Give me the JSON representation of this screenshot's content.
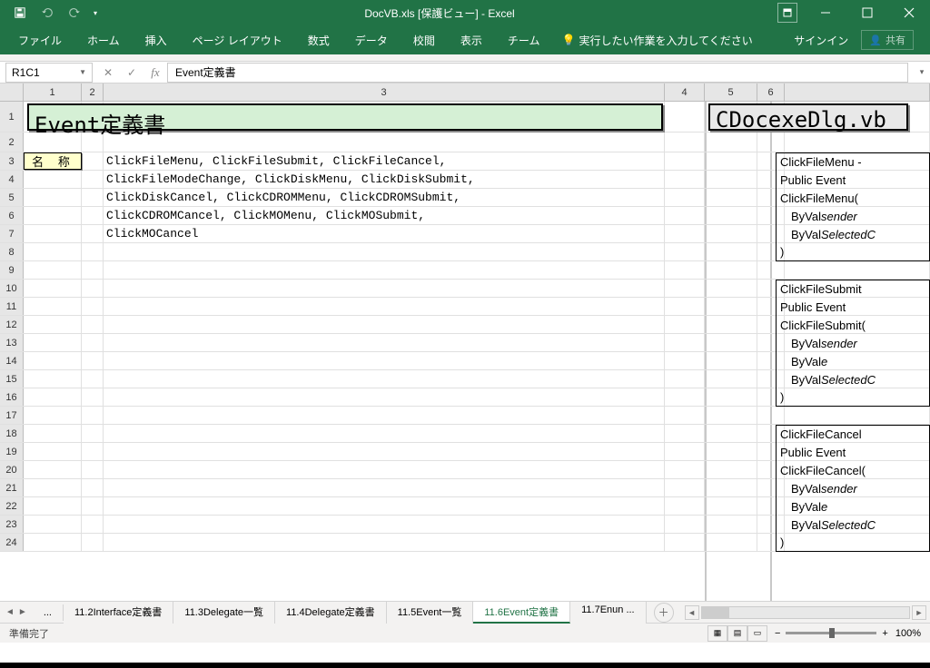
{
  "title": "DocVB.xls  [保護ビュー] - Excel",
  "ribbon": {
    "tabs": [
      "ファイル",
      "ホーム",
      "挿入",
      "ページ レイアウト",
      "数式",
      "データ",
      "校閲",
      "表示",
      "チーム"
    ],
    "tellme": "実行したい作業を入力してください",
    "signin": "サインイン",
    "share": "共有"
  },
  "namebox": "R1C1",
  "formula": "Event定義書",
  "colHeaders": [
    "1",
    "2",
    "3",
    "4",
    "5",
    "6"
  ],
  "rowHeaders": [
    "1",
    "2",
    "3",
    "4",
    "5",
    "6",
    "7",
    "8",
    "9",
    "10",
    "11",
    "12",
    "13",
    "14",
    "15",
    "16",
    "17",
    "18",
    "19",
    "20",
    "21",
    "22",
    "23",
    "24"
  ],
  "bigTitle": "Event定義書",
  "rightTitle": "CDocexeDlg.vb",
  "labelName": "名 称",
  "bodyLines": [
    "ClickFileMenu, ClickFileSubmit, ClickFileCancel,",
    "ClickFileModeChange, ClickDiskMenu, ClickDiskSubmit,",
    "ClickDiskCancel, ClickCDROMMenu, ClickCDROMSubmit,",
    "ClickCDROMCancel, ClickMOMenu, ClickMOSubmit,",
    "ClickMOCancel"
  ],
  "rightBlocks": [
    {
      "lines": [
        {
          "t": "ClickFileMenu -"
        },
        {
          "t": "Public Event"
        },
        {
          "t": "ClickFileMenu("
        },
        {
          "t": "ByVal sender",
          "i": true,
          "it": true
        },
        {
          "t": "ByVal SelectedC",
          "i": true,
          "it": true
        },
        {
          "t": ")"
        }
      ]
    },
    {
      "lines": [
        {
          "t": "ClickFileSubmit"
        },
        {
          "t": "Public Event"
        },
        {
          "t": "ClickFileSubmit("
        },
        {
          "t": "ByVal sender",
          "i": true,
          "it": true
        },
        {
          "t": "ByVal e",
          "i": true,
          "it": true
        },
        {
          "t": "ByVal SelectedC",
          "i": true,
          "it": true
        },
        {
          "t": ")"
        }
      ]
    },
    {
      "lines": [
        {
          "t": "ClickFileCancel"
        },
        {
          "t": "Public Event"
        },
        {
          "t": "ClickFileCancel("
        },
        {
          "t": "ByVal sender",
          "i": true,
          "it": true
        },
        {
          "t": "ByVal e",
          "i": true,
          "it": true
        },
        {
          "t": "ByVal SelectedC",
          "i": true,
          "it": true
        },
        {
          "t": ")"
        }
      ]
    }
  ],
  "sheetTabs": {
    "ellipsis": "...",
    "items": [
      "11.2Interface定義書",
      "11.3Delegate一覧",
      "11.4Delegate定義書",
      "11.5Event一覧",
      "11.6Event定義書",
      "11.7Enun ..."
    ],
    "activeIndex": 4
  },
  "status": {
    "ready": "準備完了",
    "zoom": "100%"
  }
}
